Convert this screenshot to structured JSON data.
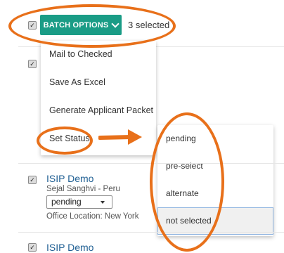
{
  "batch": {
    "button_label": "BATCH OPTIONS",
    "selected_label": "3 selected"
  },
  "menu": {
    "items": [
      "Mail to Checked",
      "Save As Excel",
      "Generate Applicant Packet",
      "Set Status"
    ]
  },
  "status_submenu": {
    "items": [
      "pending",
      "pre-select",
      "alternate",
      "not selected"
    ],
    "hovered": "not selected"
  },
  "applicants": [
    {
      "title": "ISIP Demo",
      "subtitle": "Sejal Sanghvi - Peru",
      "status": "pending",
      "location": "Office Location: New York"
    },
    {
      "title": "ISIP Demo"
    }
  ],
  "colors": {
    "accent": "#1a9c86",
    "annotation": "#e8701a",
    "link": "#1f5f93"
  },
  "icons": {
    "checkbox": "checkmark-icon",
    "dropdown": "chevron-down-icon",
    "arrow": "arrow-right-icon"
  }
}
